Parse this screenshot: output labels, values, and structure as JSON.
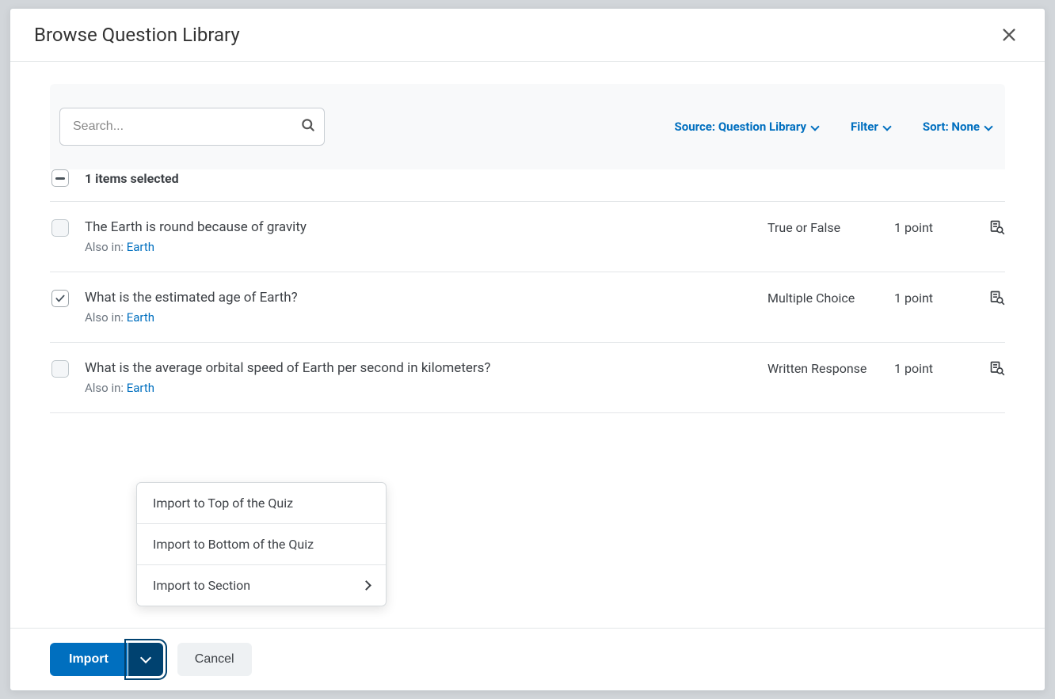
{
  "dialog": {
    "title": "Browse Question Library"
  },
  "search": {
    "placeholder": "Search..."
  },
  "filters": {
    "source_label": "Source: Question Library",
    "filter_label": "Filter",
    "sort_label": "Sort: None"
  },
  "selection": {
    "text": "1 items selected"
  },
  "questions": [
    {
      "title": "The Earth is round because of gravity",
      "also_in_label": "Also in: ",
      "also_in_link": "Earth",
      "type": "True or False",
      "points": "1 point",
      "checked": false
    },
    {
      "title": "What is the estimated age of Earth?",
      "also_in_label": "Also in: ",
      "also_in_link": "Earth",
      "type": "Multiple Choice",
      "points": "1 point",
      "checked": true
    },
    {
      "title": "What is the average orbital speed of Earth per second in kilometers?",
      "also_in_label": "Also in: ",
      "also_in_link": "Earth",
      "type": "Written Response",
      "points": "1 point",
      "checked": false
    }
  ],
  "menu": {
    "items": [
      {
        "label": "Import to Top of the Quiz",
        "chevron": false
      },
      {
        "label": "Import to Bottom of the Quiz",
        "chevron": false
      },
      {
        "label": "Import to Section",
        "chevron": true
      }
    ]
  },
  "footer": {
    "import_label": "Import",
    "cancel_label": "Cancel"
  }
}
